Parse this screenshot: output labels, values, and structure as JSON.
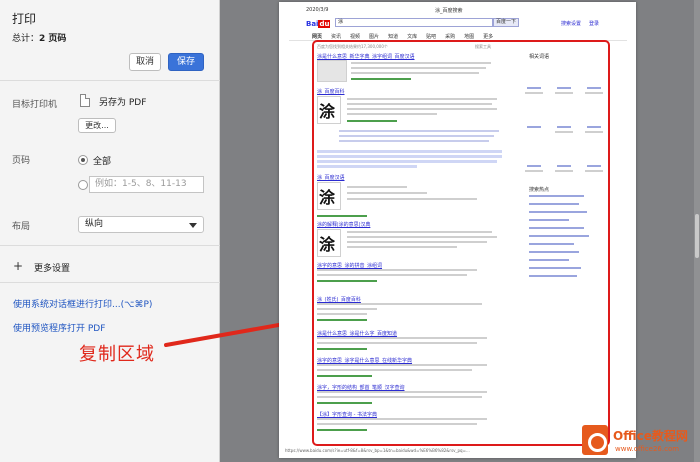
{
  "print_panel": {
    "title": "打印",
    "total_label": "总计：",
    "total_value": "2 页码",
    "cancel_label": "取消",
    "save_label": "保存",
    "destination_label": "目标打印机",
    "destination_value": "另存为 PDF",
    "change_label": "更改...",
    "pages_label": "页码",
    "pages_all": "全部",
    "pages_placeholder": "例如：1-5、8、11-13",
    "layout_label": "布局",
    "layout_value": "纵向",
    "more_settings": "更多设置",
    "system_dialog": "使用系统对话框进行打印...(⌥⌘P)",
    "preview_open": "使用预览程序打开 PDF"
  },
  "annotation": {
    "label": "复制区域",
    "color": "#e0281b"
  },
  "preview": {
    "header_date": "2020/3/9",
    "header_title": "涂_百度搜索",
    "search_query": "涂",
    "search_button": "百度一下",
    "top_links": [
      "搜索设置",
      "登录"
    ],
    "tabs": [
      "网页",
      "资讯",
      "视频",
      "图片",
      "知道",
      "文库",
      "贴吧",
      "采购",
      "地图",
      "更多"
    ],
    "result_count": "百度为您找到相关结果约17,300,000个",
    "tools": "搜索工具",
    "results": [
      "涂是什么意思_新华字典_涂字组词_百度汉语",
      "涂_百度百科",
      "涂_百度汉语",
      "涂的解释|涂的意思|汉典",
      "涂字的意思_涂的拼音_涂组词",
      "涂_(姓氏)_百度百科",
      "涂是什么意思_涂是什么字_百度知道",
      "涂字的意思_涂字是什么意思_在线新华字典",
      "涂字，字形的结构_部首_笔顺_汉字查询",
      "【涂】字形查询 - 书法字典"
    ],
    "related_title": "相关词语",
    "hot_title": "搜索热点",
    "footer_url": "https://www.baidu.com/s?ie=utf-8&f=8&rsv_bp=1&tn=baidu&wd=%E6%B6%82&rsv_pq=..."
  },
  "watermark": {
    "brand": "Office教程网",
    "url": "www.office26.com",
    "color": "#e65a1d"
  }
}
